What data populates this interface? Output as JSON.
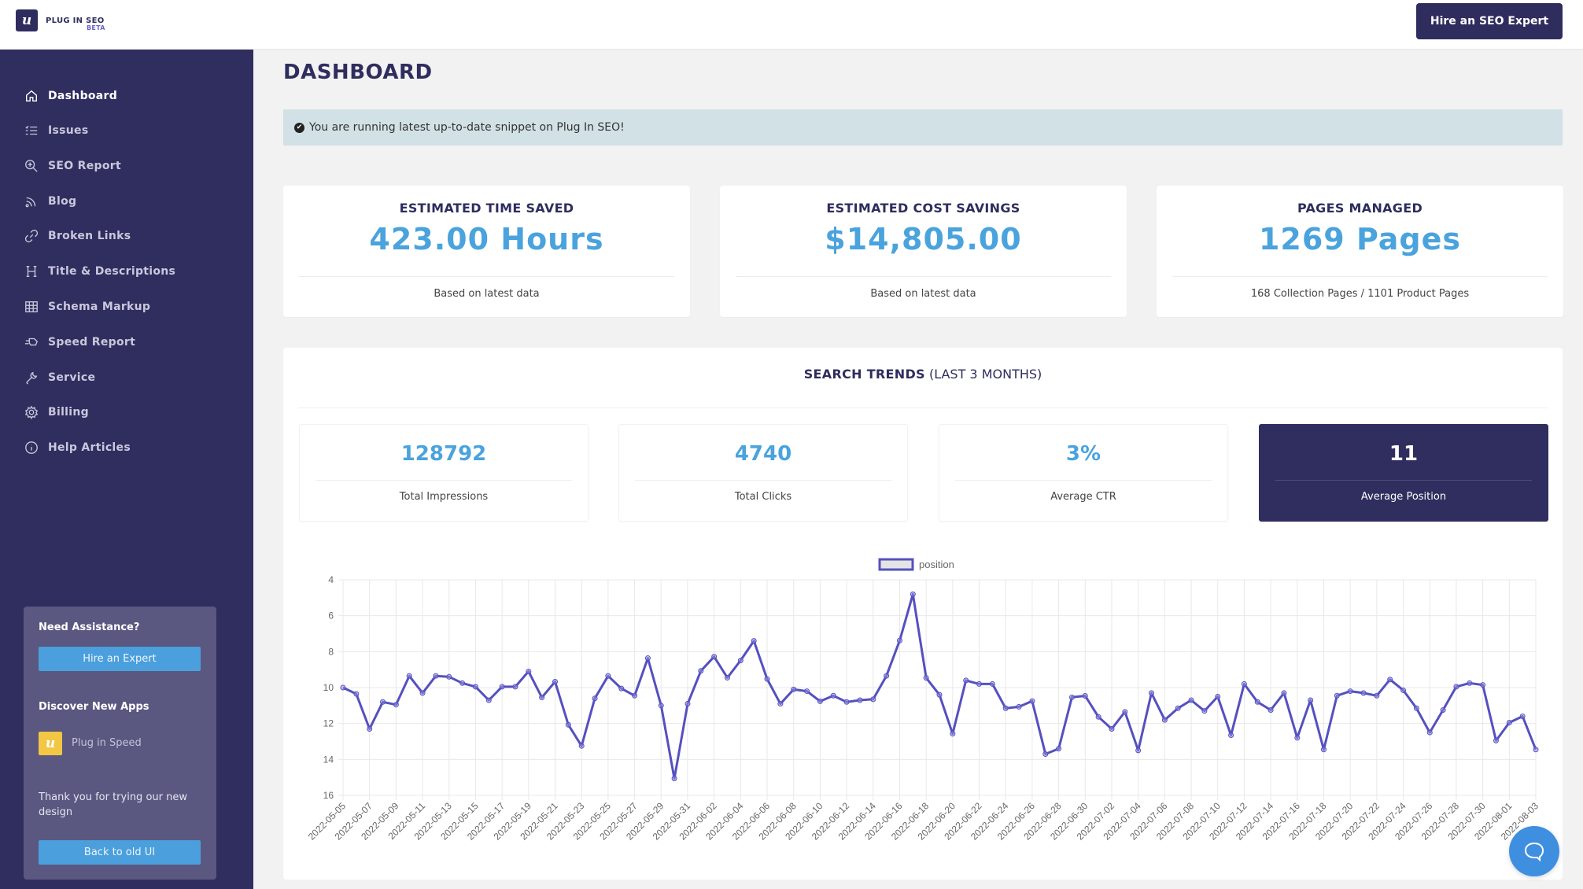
{
  "app": {
    "logo_letter": "u",
    "name": "PLUG IN SEO",
    "badge": "BETA",
    "hire_button": "Hire an SEO Expert"
  },
  "sidebar": {
    "items": [
      {
        "label": "Dashboard",
        "icon": "home-icon",
        "active": true
      },
      {
        "label": "Issues",
        "icon": "checklist-icon"
      },
      {
        "label": "SEO Report",
        "icon": "zoom-in-icon"
      },
      {
        "label": "Blog",
        "icon": "rss-icon"
      },
      {
        "label": "Broken Links",
        "icon": "link-icon"
      },
      {
        "label": "Title & Descriptions",
        "icon": "heading-icon"
      },
      {
        "label": "Schema Markup",
        "icon": "table-icon"
      },
      {
        "label": "Speed Report",
        "icon": "speed-icon"
      },
      {
        "label": "Service",
        "icon": "wrench-icon"
      },
      {
        "label": "Billing",
        "icon": "gear-icon"
      },
      {
        "label": "Help Articles",
        "icon": "info-icon"
      }
    ],
    "assist": {
      "heading": "Need Assistance?",
      "hire_button": "Hire an Expert",
      "apps_heading": "Discover New Apps",
      "app_name": "Plug in Speed",
      "thanks": "Thank you for trying our new design",
      "back_button": "Back to old UI"
    }
  },
  "main": {
    "title": "DASHBOARD",
    "alert": "You are running latest up-to-date snippet on Plug In SEO!",
    "cards": [
      {
        "title": "ESTIMATED TIME SAVED",
        "value": "423.00 Hours",
        "sub": "Based on latest data"
      },
      {
        "title": "ESTIMATED COST SAVINGS",
        "value": "$14,805.00",
        "sub": "Based on latest data"
      },
      {
        "title": "PAGES MANAGED",
        "value": "1269 Pages",
        "sub": "168 Collection Pages / 1101 Product Pages"
      }
    ],
    "trends": {
      "title_bold": "SEARCH TRENDS",
      "title_rest": " (LAST 3 MONTHS)",
      "stats": [
        {
          "value": "128792",
          "label": "Total Impressions"
        },
        {
          "value": "4740",
          "label": "Total Clicks"
        },
        {
          "value": "3%",
          "label": "Average CTR"
        },
        {
          "value": "11",
          "label": "Average Position",
          "highlight": true
        }
      ]
    }
  },
  "colors": {
    "brand": "#2f2d5e",
    "accent": "#4aa3dd",
    "series": "#5550c0",
    "chat": "#3f8fe0"
  },
  "chart_data": {
    "type": "line",
    "title": "",
    "xlabel": "",
    "ylabel": "",
    "legend": {
      "entries": [
        "position"
      ],
      "placement": "top"
    },
    "y_reversed": true,
    "ylim": [
      4,
      16
    ],
    "y_ticks": [
      4,
      6,
      8,
      10,
      12,
      14,
      16
    ],
    "grid": true,
    "x_start": "2022-05-05",
    "x_end": "2022-08-03",
    "x_tick_every": 2,
    "series": [
      {
        "name": "position",
        "values": [
          10.0,
          10.35,
          12.3,
          10.8,
          10.95,
          9.35,
          10.3,
          9.35,
          9.4,
          9.75,
          9.95,
          10.7,
          9.95,
          9.95,
          9.1,
          10.55,
          9.67,
          12.07,
          13.25,
          10.6,
          9.35,
          10.05,
          10.45,
          8.36,
          11.0,
          15.06,
          10.9,
          9.07,
          8.28,
          9.45,
          8.49,
          7.4,
          9.52,
          10.9,
          10.1,
          10.2,
          10.76,
          10.45,
          10.8,
          10.7,
          10.65,
          9.35,
          7.38,
          4.8,
          9.46,
          10.4,
          12.57,
          9.6,
          9.8,
          9.8,
          11.15,
          11.07,
          10.75,
          13.7,
          13.4,
          10.54,
          10.46,
          11.63,
          12.3,
          11.35,
          13.5,
          10.3,
          11.8,
          11.15,
          10.7,
          11.3,
          10.5,
          12.65,
          9.8,
          10.8,
          11.25,
          10.3,
          12.8,
          10.7,
          13.45,
          10.45,
          10.2,
          10.3,
          10.45,
          9.55,
          10.15,
          11.15,
          12.5,
          11.25,
          9.95,
          9.75,
          9.85,
          12.95,
          11.95,
          11.6,
          13.45
        ]
      }
    ]
  }
}
